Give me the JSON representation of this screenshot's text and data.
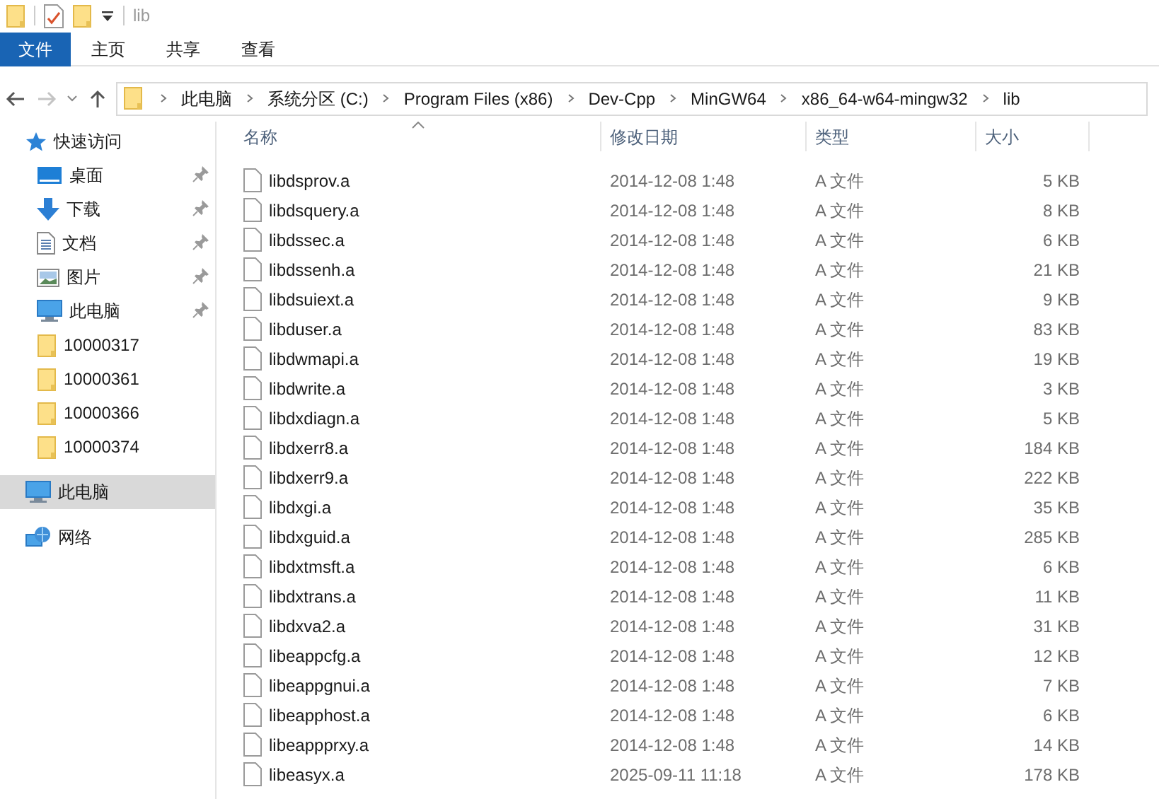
{
  "title_bar": {
    "title": "lib"
  },
  "ribbon_tabs": [
    {
      "label": "文件",
      "kind": "file"
    },
    {
      "label": "主页",
      "kind": "tab"
    },
    {
      "label": "共享",
      "kind": "tab"
    },
    {
      "label": "查看",
      "kind": "tab"
    }
  ],
  "address_bar": {
    "path": [
      "此电脑",
      "系统分区 (C:)",
      "Program Files (x86)",
      "Dev-Cpp",
      "MinGW64",
      "x86_64-w64-mingw32",
      "lib"
    ]
  },
  "sidebar": {
    "quick_access": {
      "label": "快速访问",
      "items": [
        {
          "label": "桌面",
          "kind": "desktop",
          "pinned": true
        },
        {
          "label": "下载",
          "kind": "download",
          "pinned": true
        },
        {
          "label": "文档",
          "kind": "documents",
          "pinned": true
        },
        {
          "label": "图片",
          "kind": "pictures",
          "pinned": true
        },
        {
          "label": "此电脑",
          "kind": "pc",
          "pinned": true
        },
        {
          "label": "10000317",
          "kind": "folder",
          "pinned": false
        },
        {
          "label": "10000361",
          "kind": "folder",
          "pinned": false
        },
        {
          "label": "10000366",
          "kind": "folder",
          "pinned": false
        },
        {
          "label": "10000374",
          "kind": "folder",
          "pinned": false
        }
      ]
    },
    "items": [
      {
        "label": "此电脑",
        "kind": "pc",
        "selected": true
      },
      {
        "label": "网络",
        "kind": "network",
        "selected": false
      }
    ]
  },
  "table": {
    "columns": [
      "名称",
      "修改日期",
      "类型",
      "大小"
    ],
    "rows": [
      {
        "name": "libdsprov.a",
        "date": "2014-12-08 1:48",
        "type": "A 文件",
        "size": "5 KB"
      },
      {
        "name": "libdsquery.a",
        "date": "2014-12-08 1:48",
        "type": "A 文件",
        "size": "8 KB"
      },
      {
        "name": "libdssec.a",
        "date": "2014-12-08 1:48",
        "type": "A 文件",
        "size": "6 KB"
      },
      {
        "name": "libdssenh.a",
        "date": "2014-12-08 1:48",
        "type": "A 文件",
        "size": "21 KB"
      },
      {
        "name": "libdsuiext.a",
        "date": "2014-12-08 1:48",
        "type": "A 文件",
        "size": "9 KB"
      },
      {
        "name": "libduser.a",
        "date": "2014-12-08 1:48",
        "type": "A 文件",
        "size": "83 KB"
      },
      {
        "name": "libdwmapi.a",
        "date": "2014-12-08 1:48",
        "type": "A 文件",
        "size": "19 KB"
      },
      {
        "name": "libdwrite.a",
        "date": "2014-12-08 1:48",
        "type": "A 文件",
        "size": "3 KB"
      },
      {
        "name": "libdxdiagn.a",
        "date": "2014-12-08 1:48",
        "type": "A 文件",
        "size": "5 KB"
      },
      {
        "name": "libdxerr8.a",
        "date": "2014-12-08 1:48",
        "type": "A 文件",
        "size": "184 KB"
      },
      {
        "name": "libdxerr9.a",
        "date": "2014-12-08 1:48",
        "type": "A 文件",
        "size": "222 KB"
      },
      {
        "name": "libdxgi.a",
        "date": "2014-12-08 1:48",
        "type": "A 文件",
        "size": "35 KB"
      },
      {
        "name": "libdxguid.a",
        "date": "2014-12-08 1:48",
        "type": "A 文件",
        "size": "285 KB"
      },
      {
        "name": "libdxtmsft.a",
        "date": "2014-12-08 1:48",
        "type": "A 文件",
        "size": "6 KB"
      },
      {
        "name": "libdxtrans.a",
        "date": "2014-12-08 1:48",
        "type": "A 文件",
        "size": "11 KB"
      },
      {
        "name": "libdxva2.a",
        "date": "2014-12-08 1:48",
        "type": "A 文件",
        "size": "31 KB"
      },
      {
        "name": "libeappcfg.a",
        "date": "2014-12-08 1:48",
        "type": "A 文件",
        "size": "12 KB"
      },
      {
        "name": "libeappgnui.a",
        "date": "2014-12-08 1:48",
        "type": "A 文件",
        "size": "7 KB"
      },
      {
        "name": "libeapphost.a",
        "date": "2014-12-08 1:48",
        "type": "A 文件",
        "size": "6 KB"
      },
      {
        "name": "libeappprxy.a",
        "date": "2014-12-08 1:48",
        "type": "A 文件",
        "size": "14 KB"
      },
      {
        "name": "libeasyx.a",
        "date": "2025-09-11 11:18",
        "type": "A 文件",
        "size": "178 KB"
      }
    ]
  }
}
